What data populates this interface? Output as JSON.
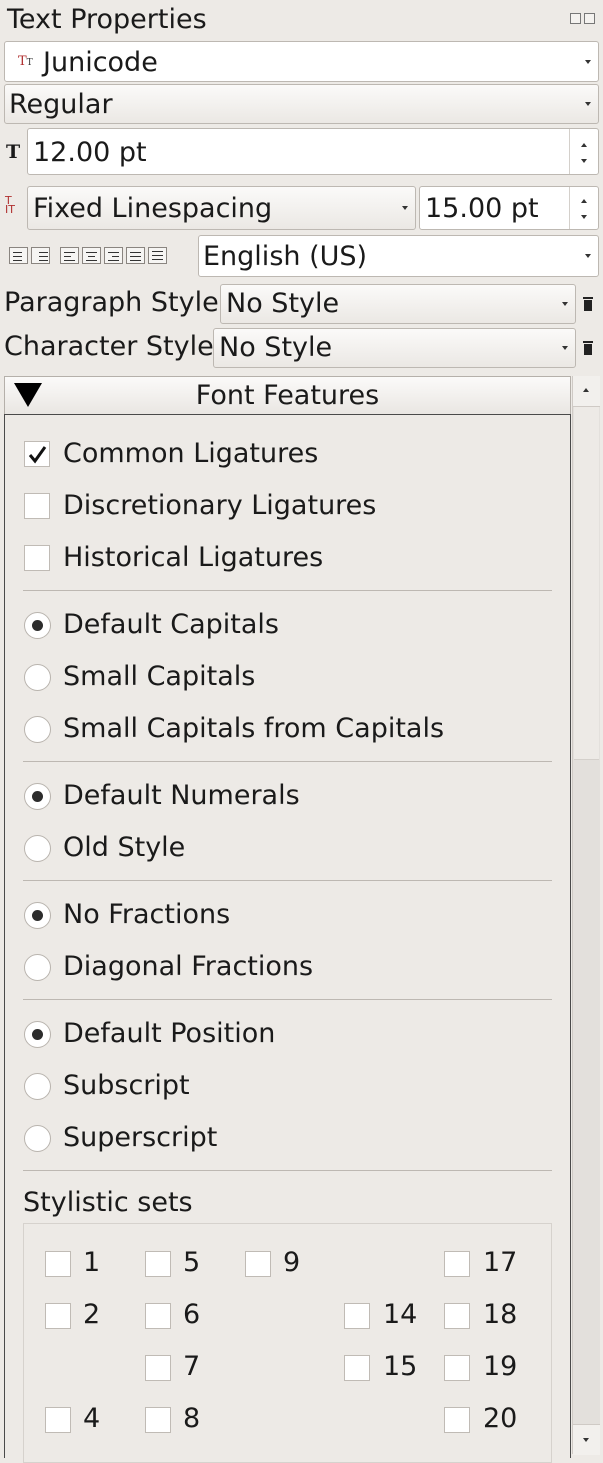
{
  "panel_title": "Text Properties",
  "font": {
    "family": "Junicode",
    "style": "Regular",
    "size": "12.00 pt"
  },
  "linespacing": {
    "mode": "Fixed Linespacing",
    "value": "15.00 pt"
  },
  "language": "English (US)",
  "paragraph_style": {
    "label": "Paragraph Style:",
    "value": "No Style"
  },
  "character_style": {
    "label": "Character Style:",
    "value": "No Style"
  },
  "font_features": {
    "header": "Font Features",
    "ligatures": [
      {
        "label": "Common Ligatures",
        "checked": true
      },
      {
        "label": "Discretionary Ligatures",
        "checked": false
      },
      {
        "label": "Historical Ligatures",
        "checked": false
      }
    ],
    "capitals": [
      {
        "label": "Default Capitals",
        "selected": true
      },
      {
        "label": "Small Capitals",
        "selected": false
      },
      {
        "label": "Small Capitals from Capitals",
        "selected": false
      }
    ],
    "numerals": [
      {
        "label": "Default Numerals",
        "selected": true
      },
      {
        "label": "Old Style",
        "selected": false
      }
    ],
    "fractions": [
      {
        "label": "No Fractions",
        "selected": true
      },
      {
        "label": "Diagonal Fractions",
        "selected": false
      }
    ],
    "position": [
      {
        "label": "Default Position",
        "selected": true
      },
      {
        "label": "Subscript",
        "selected": false
      },
      {
        "label": "Superscript",
        "selected": false
      }
    ],
    "stylistic_sets_label": "Stylistic sets",
    "stylistic_sets": [
      "1",
      "5",
      "9",
      "17",
      "2",
      "6",
      "14",
      "18",
      "7",
      "15",
      "19",
      "4",
      "8",
      "20"
    ]
  },
  "icons": [
    "font-type-icon",
    "font-size-icon",
    "linespacing-icon",
    "trash-icon",
    "triangle-down-icon",
    "checkmark-icon"
  ]
}
